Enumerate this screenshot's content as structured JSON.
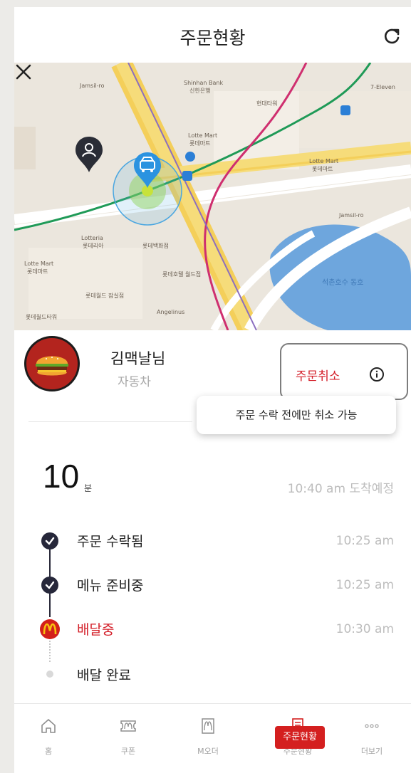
{
  "header": {
    "title": "주문현황"
  },
  "map": {
    "labels": {
      "shinhan": "Shinhan Bank",
      "shinhan_kr": "신한은행",
      "lottemart1": "Lotte Mart",
      "lottemart1_kr": "롯데마트",
      "lottemart2": "Lotte Mart",
      "lottemart2_kr": "롯데마트",
      "lottemart3": "Lotte Mart",
      "lottemart3_kr": "롯데마트",
      "lotteria": "Lotteria",
      "lotteria_kr": "롯데리아",
      "seven": "7-Eleven",
      "jamsil_ro1": "Jamsil-ro",
      "jamsil_ro2": "Jamsil-ro",
      "lake": "석촌호수 동호",
      "angelinus": "Angelinus",
      "hyundai": "현대타워",
      "lotte_hotel": "롯데호텔 월드점",
      "lotte_dept": "롯데백화점",
      "lotte_world": "롯데월드 잠실점",
      "lotte_world_mall": "롯데월드타워"
    }
  },
  "customer": {
    "name": "김맥날님",
    "vehicle": "자동차",
    "cancel_label": "주문취소",
    "tooltip": "주문 수락 전에만 취소 가능"
  },
  "eta": {
    "minutes": "10",
    "unit": "분",
    "arrival": "10:40 am 도착예정"
  },
  "steps": [
    {
      "label": "주문 수락됨",
      "time": "10:25 am"
    },
    {
      "label": "메뉴 준비중",
      "time": "10:25 am"
    },
    {
      "label": "배달중",
      "time": "10:30 am"
    },
    {
      "label": "배달 완료",
      "time": ""
    }
  ],
  "nav": {
    "items": [
      {
        "label": "홈"
      },
      {
        "label": "쿠폰"
      },
      {
        "label": "M오더"
      },
      {
        "label": "주문현황"
      },
      {
        "label": "더보기"
      }
    ],
    "active_badge": "주문현황"
  },
  "colors": {
    "accent": "#d4202a",
    "dark": "#26273a"
  }
}
